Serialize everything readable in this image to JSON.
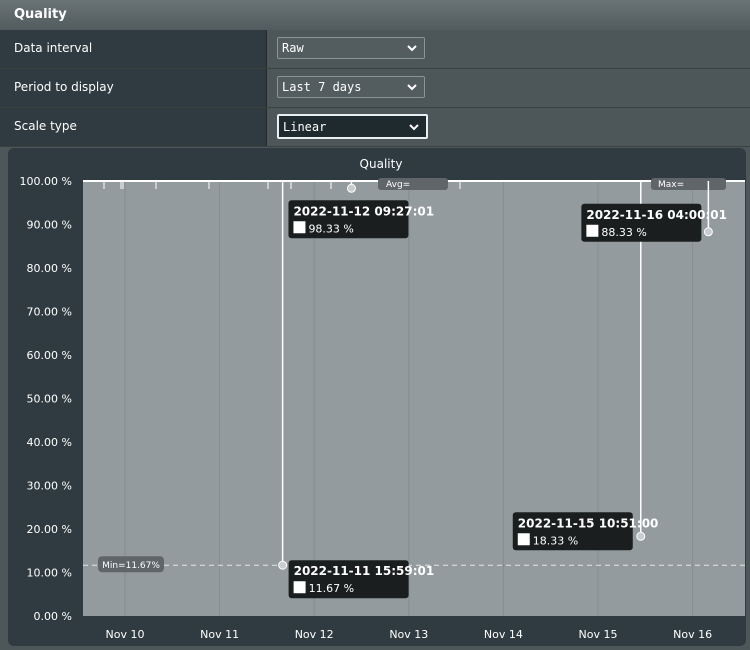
{
  "header": {
    "title": "Quality"
  },
  "settings": [
    {
      "label": "Data interval",
      "value": "Raw"
    },
    {
      "label": "Period to display",
      "value": "Last 7 days"
    },
    {
      "label": "Scale type",
      "value": "Linear"
    }
  ],
  "chart_data": {
    "type": "line",
    "title": "Quality",
    "xlabel": "",
    "ylabel": "",
    "ylim": [
      0,
      100
    ],
    "yticks": [
      "0.00 %",
      "10.00 %",
      "20.00 %",
      "30.00 %",
      "40.00 %",
      "50.00 %",
      "60.00 %",
      "70.00 %",
      "80.00 %",
      "90.00 %",
      "100.00 %"
    ],
    "xticks": [
      "Nov 10",
      "Nov 11",
      "Nov 12",
      "Nov 13",
      "Nov 14",
      "Nov 15",
      "Nov 16"
    ],
    "baseline": 100,
    "dips": [
      {
        "x": "2022-11-11 15:59:01",
        "y": 11.67,
        "label_time": "2022-11-11 15:59:01",
        "label_value": "11.67 %"
      },
      {
        "x": "2022-11-12 09:27:01",
        "y": 98.33,
        "label_time": "2022-11-12 09:27:01",
        "label_value": "98.33 %"
      },
      {
        "x": "2022-11-15 10:51:00",
        "y": 18.33,
        "label_time": "2022-11-15 10:51:00",
        "label_value": "18.33 %"
      },
      {
        "x": "2022-11-16 04:00:01",
        "y": 88.33,
        "label_time": "2022-11-16 04:00:01",
        "label_value": "88.33 %"
      }
    ],
    "min_line": {
      "y": 11.67,
      "label": "Min=11.67%"
    },
    "avg_label": "Avg=",
    "max_label": "Max="
  }
}
